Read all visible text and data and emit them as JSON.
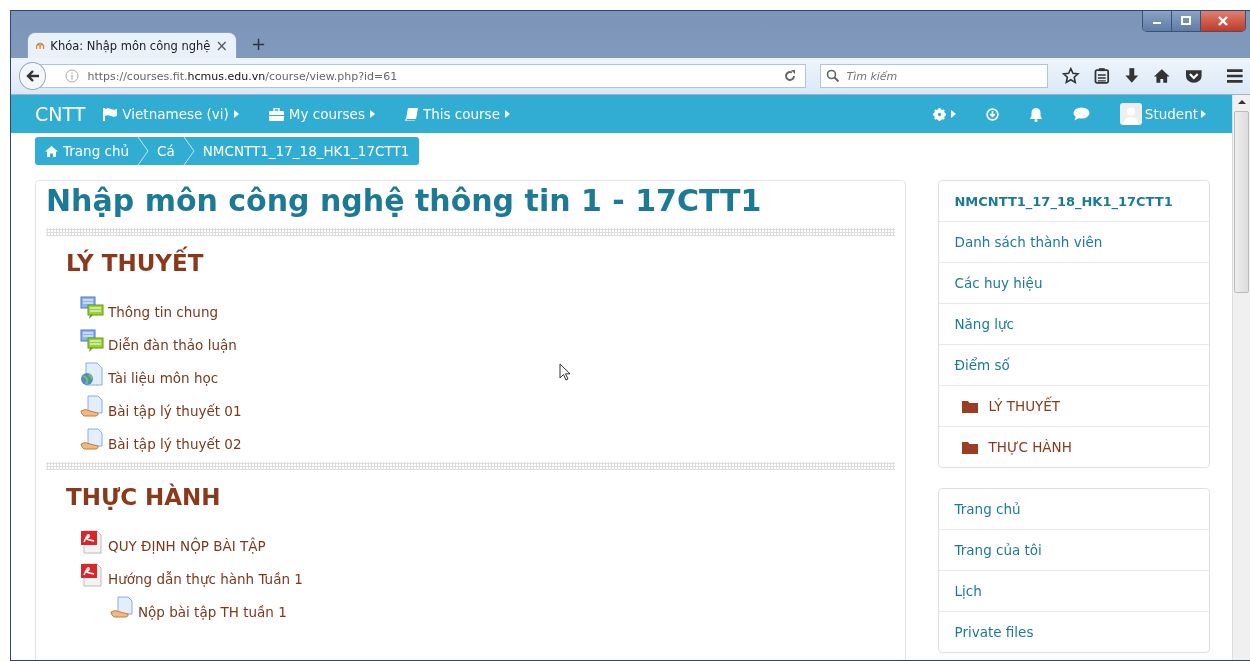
{
  "browser": {
    "tab": {
      "title": "Khóa: Nhập môn công nghệ",
      "close": "×",
      "selected": true
    },
    "new_tab": "+",
    "url": "https://courses.fit.**hcmus.edu.vn**/course/view.php?id=61",
    "search": {
      "placeholder": "Tìm kiếm"
    }
  },
  "navbar": {
    "brand": "CNTT",
    "menus": [
      {
        "kind": "flag",
        "label": "Vietnamese (vi)"
      },
      {
        "kind": "briefcase",
        "label": "My courses"
      },
      {
        "kind": "book",
        "label": "This course"
      }
    ],
    "user": "Student"
  },
  "breadcrumbs": [
    {
      "kind": "home",
      "label": "Trang chủ"
    },
    {
      "kind": "link",
      "label": "Cá"
    },
    {
      "kind": "link",
      "label": "NMCNTT1_17_18_HK1_17CTT1"
    }
  ],
  "course": {
    "title": "Nhập môn công nghệ thông tin 1 - 17CTT1",
    "sections": [
      {
        "title": "LÝ THUYẾT",
        "activities": [
          {
            "kind": "forum",
            "label": "Thông tin chung"
          },
          {
            "kind": "forum",
            "label": "Diễn đàn thảo luận"
          },
          {
            "kind": "url",
            "label": "Tài liệu môn học"
          },
          {
            "kind": "assign",
            "label": "Bài tập lý thuyết 01"
          },
          {
            "kind": "assign",
            "label": "Bài tập lý thuyết 02"
          }
        ]
      },
      {
        "title": "THỰC HÀNH",
        "activities": [
          {
            "kind": "pdf",
            "label": "QUY ĐỊNH NỘP BÀI TẬP"
          },
          {
            "kind": "pdf",
            "label": "Hướng dẫn thực hành Tuần 1",
            "children": [
              {
                "kind": "assign",
                "label": "Nộp bài tập TH tuần 1"
              }
            ]
          }
        ]
      }
    ]
  },
  "blocks": [
    {
      "items": [
        {
          "kind": "header",
          "label": "NMCNTT1_17_18_HK1_17CTT1"
        },
        {
          "kind": "link",
          "label": "Danh sách thành viên"
        },
        {
          "kind": "link",
          "label": "Các huy hiệu"
        },
        {
          "kind": "link",
          "label": "Năng lực"
        },
        {
          "kind": "link",
          "label": "Điểm số"
        },
        {
          "kind": "folder",
          "label": "LÝ THUYẾT"
        },
        {
          "kind": "folder",
          "label": "THỰC HÀNH"
        }
      ]
    },
    {
      "items": [
        {
          "kind": "link",
          "label": "Trang chủ"
        },
        {
          "kind": "link",
          "label": "Trang của tôi"
        },
        {
          "kind": "link",
          "label": "Lịch"
        },
        {
          "kind": "link",
          "label": "Private files"
        }
      ]
    }
  ]
}
